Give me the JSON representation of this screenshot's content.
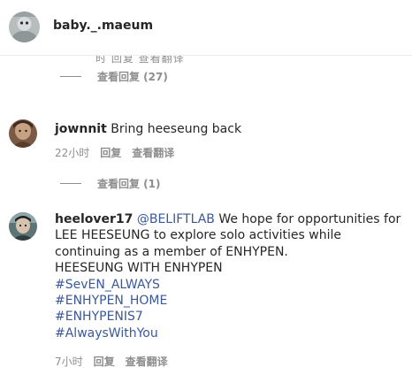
{
  "header": {
    "username": "baby._.maeum",
    "clipped_meta": "时  回复  查看翻译"
  },
  "thread1": {
    "view_replies": "查看回复 (27)"
  },
  "comment2": {
    "username": "jownnit",
    "text": "Bring heeseung back",
    "time": "22小时",
    "reply": "回复",
    "translate": "查看翻译",
    "view_replies": "查看回复 (1)"
  },
  "comment3": {
    "username": "heelover17",
    "mention": "@BELIFTLAB",
    "text_1": "We hope for opportunities for LEE HEESEUNG to explore solo activities while continuing as a member of ENHYPEN.",
    "text_2": "HEESEUNG WITH ENHYPEN",
    "hashtags": [
      "#SevEN_ALWAYS",
      "#ENHYPEN_HOME",
      "#ENHYPENIS7",
      "#AlwaysWithYou"
    ],
    "time": "7小时",
    "reply": "回复",
    "translate": "查看翻译"
  },
  "icons": {
    "avatar1": "profile-photo-gray",
    "avatar2": "profile-photo-brown",
    "avatar3": "profile-photo-teal"
  }
}
